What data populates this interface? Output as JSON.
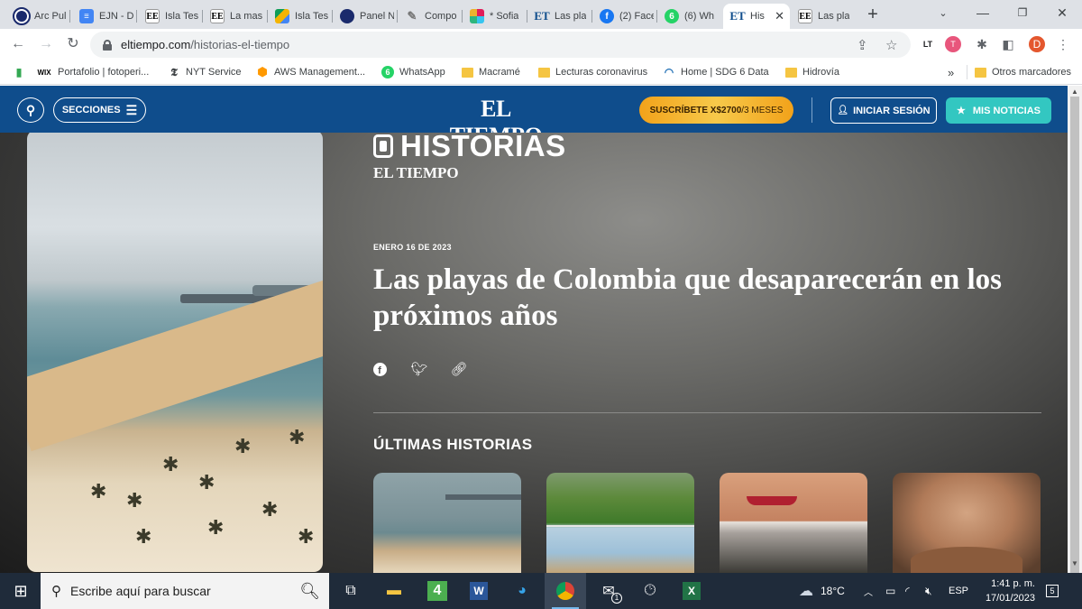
{
  "tabs": [
    {
      "title": "Arc Pul",
      "icon": "circle-o-icon"
    },
    {
      "title": "EJN - D",
      "icon": "docs-icon"
    },
    {
      "title": "Isla Tes",
      "icon": "ee-icon"
    },
    {
      "title": "La mas",
      "icon": "ee-icon"
    },
    {
      "title": "Isla Tes",
      "icon": "drive-icon"
    },
    {
      "title": "Panel N",
      "icon": "circle-o-icon"
    },
    {
      "title": "Compo",
      "icon": "pencil-icon"
    },
    {
      "title": "* Sofia",
      "icon": "slack-icon"
    },
    {
      "title": "Las pla",
      "icon": "et-icon"
    },
    {
      "title": "(2) Face",
      "icon": "facebook-icon"
    },
    {
      "title": "(6) Wh",
      "icon": "whatsapp-icon"
    },
    {
      "title": "His",
      "icon": "et-icon",
      "active": true
    },
    {
      "title": "Las pla",
      "icon": "ee-icon"
    }
  ],
  "omnibox": {
    "domain": "eltiempo.com",
    "path": "/historias-el-tiempo"
  },
  "profile_initial": "D",
  "bookmarks": [
    {
      "label": "Portafolio | fotoperi...",
      "icon": "wix-icon",
      "badge": "WIX"
    },
    {
      "label": "NYT Service",
      "icon": "nyt-icon"
    },
    {
      "label": "AWS Management...",
      "icon": "aws-icon"
    },
    {
      "label": "WhatsApp",
      "icon": "whatsapp-icon"
    },
    {
      "label": "Macramé",
      "icon": "folder-icon"
    },
    {
      "label": "Lecturas coronavirus",
      "icon": "folder-icon"
    },
    {
      "label": "Home | SDG 6 Data",
      "icon": "un-icon"
    },
    {
      "label": "Hidrovía",
      "icon": "folder-icon"
    }
  ],
  "bookmarks_more": "»",
  "other_bookmarks": "Otros marcadores",
  "site": {
    "sections_label": "SECCIONES",
    "logo": "EL TIEMPO",
    "subscribe_prefix": "SUSCRÍBETE X ",
    "subscribe_price": "$2700",
    "subscribe_period": "/3 MESES",
    "login_label": "INICIAR SESIÓN",
    "my_news_label": "MIS NOTICIAS"
  },
  "hero": {
    "brand_top": "HISTORIAS",
    "brand_bottom": "EL TIEMPO",
    "date": "ENERO 16 DE 2023",
    "headline": "Las playas de Colombia que desaparecerán en los próximos años",
    "latest_heading": "ÚLTIMAS HISTORIAS"
  },
  "taskbar": {
    "search_placeholder": "Escribe aquí para buscar",
    "weather": "18°C",
    "language": "ESP",
    "time": "1:41 p. m.",
    "date": "17/01/2023",
    "notifications": "5",
    "mail_badge": "1",
    "edge_badge": "4"
  }
}
